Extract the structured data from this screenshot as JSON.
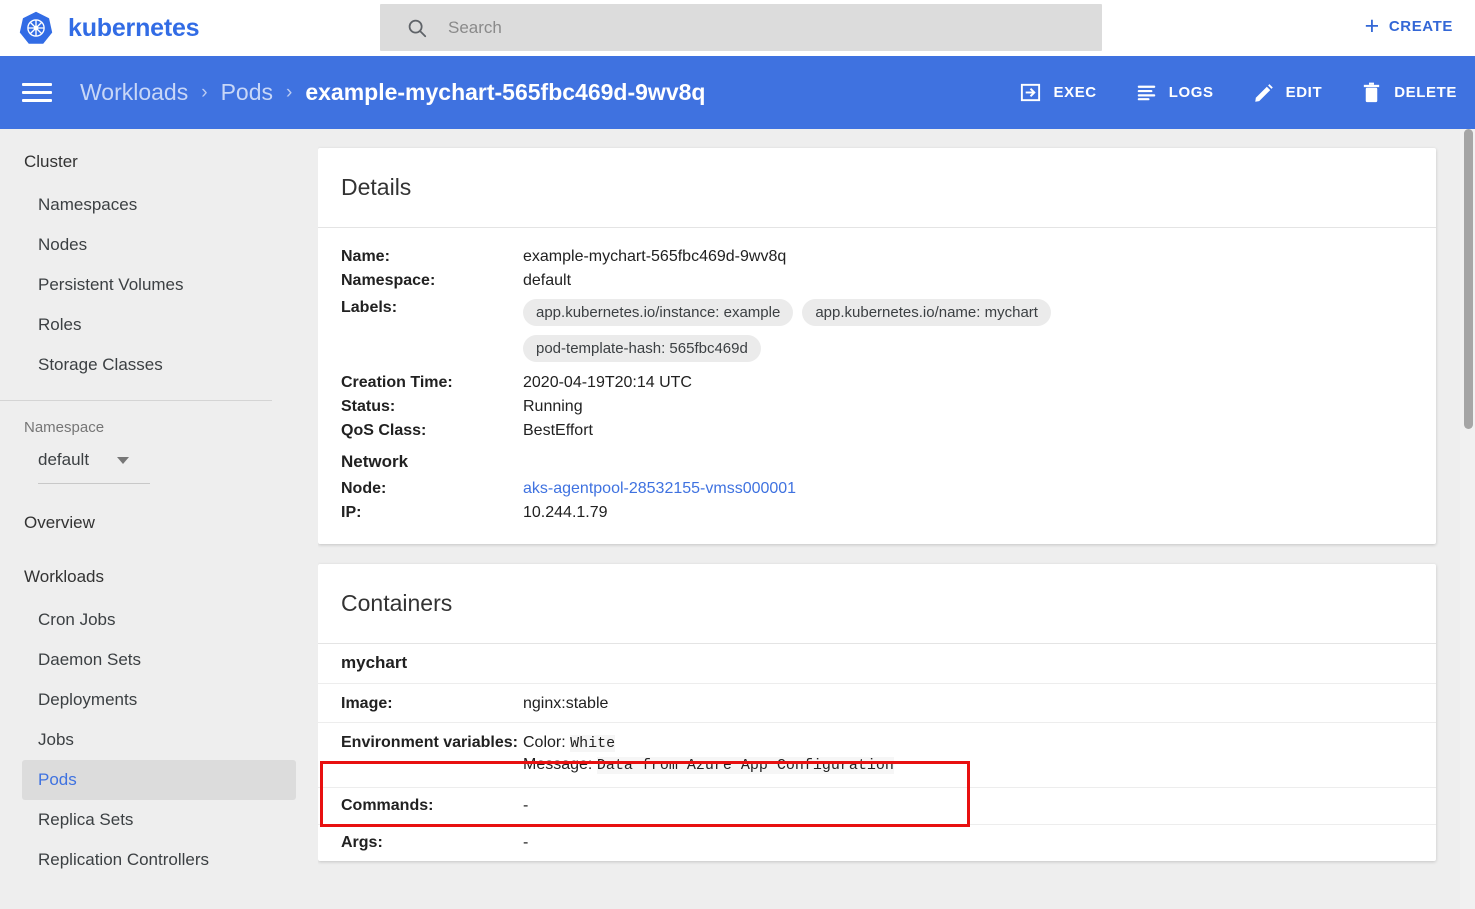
{
  "header": {
    "brand": "kubernetes",
    "logo_icon": "kubernetes-helm-wheel-icon",
    "search": {
      "icon": "search-icon",
      "placeholder": "Search",
      "value": ""
    },
    "create_label": "CREATE",
    "create_icon": "plus-icon"
  },
  "breadcrumb_bar": {
    "menu_icon": "hamburger-menu-icon",
    "crumbs": [
      {
        "label": "Workloads",
        "current": false
      },
      {
        "label": "Pods",
        "current": false
      },
      {
        "label": "example-mychart-565fbc469d-9wv8q",
        "current": true
      }
    ],
    "separator": "›",
    "actions": [
      {
        "label": "EXEC",
        "icon": "exec-terminal-icon"
      },
      {
        "label": "LOGS",
        "icon": "logs-lines-icon"
      },
      {
        "label": "EDIT",
        "icon": "pencil-edit-icon"
      },
      {
        "label": "DELETE",
        "icon": "trash-delete-icon"
      }
    ]
  },
  "sidebar": {
    "cluster_heading": "Cluster",
    "cluster_items": [
      {
        "label": "Namespaces",
        "active": false
      },
      {
        "label": "Nodes",
        "active": false
      },
      {
        "label": "Persistent Volumes",
        "active": false
      },
      {
        "label": "Roles",
        "active": false
      },
      {
        "label": "Storage Classes",
        "active": false
      }
    ],
    "namespace_label": "Namespace",
    "namespace_value": "default",
    "namespace_caret_icon": "chevron-down-icon",
    "overview_heading": "Overview",
    "workloads_heading": "Workloads",
    "workloads_items": [
      {
        "label": "Cron Jobs",
        "active": false
      },
      {
        "label": "Daemon Sets",
        "active": false
      },
      {
        "label": "Deployments",
        "active": false
      },
      {
        "label": "Jobs",
        "active": false
      },
      {
        "label": "Pods",
        "active": true
      },
      {
        "label": "Replica Sets",
        "active": false
      },
      {
        "label": "Replication Controllers",
        "active": false
      }
    ]
  },
  "details_card": {
    "title": "Details",
    "name_label": "Name:",
    "name_value": "example-mychart-565fbc469d-9wv8q",
    "namespace_label": "Namespace:",
    "namespace_value": "default",
    "labels_label": "Labels:",
    "labels": [
      "app.kubernetes.io/instance: example",
      "app.kubernetes.io/name: mychart",
      "pod-template-hash: 565fbc469d"
    ],
    "creation_label": "Creation Time:",
    "creation_value": "2020-04-19T20:14 UTC",
    "status_label": "Status:",
    "status_value": "Running",
    "qos_label": "QoS Class:",
    "qos_value": "BestEffort",
    "network_heading": "Network",
    "node_label": "Node:",
    "node_value": "aks-agentpool-28532155-vmss000001",
    "ip_label": "IP:",
    "ip_value": "10.244.1.79"
  },
  "containers_card": {
    "title": "Containers",
    "container_name": "mychart",
    "image_label": "Image:",
    "image_value": "nginx:stable",
    "env_label": "Environment variables:",
    "env_vars": [
      {
        "key": "Color:",
        "value": "White"
      },
      {
        "key": "Message:",
        "value": "Data from Azure App Configuration"
      }
    ],
    "commands_label": "Commands:",
    "commands_value": "-",
    "args_label": "Args:",
    "args_value": "-"
  },
  "annotations": {
    "highlight_color": "#e81010",
    "highlight_target": "environment-variables-row"
  },
  "colors": {
    "brand_blue": "#326ce5",
    "bar_blue": "#3f72e0",
    "link_blue": "#3f72e0",
    "page_bg": "#eeeeee",
    "card_bg": "#ffffff",
    "chip_bg": "#ebebeb"
  }
}
